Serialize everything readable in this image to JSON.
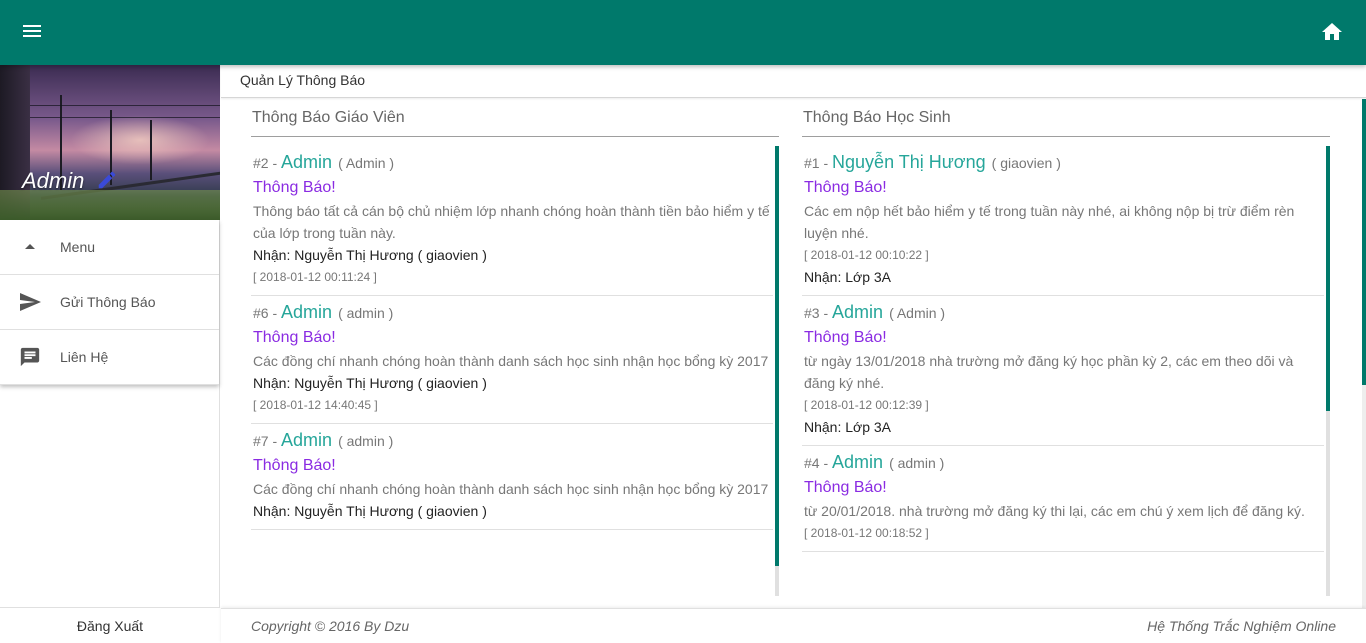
{
  "header": {
    "menu_icon": "hamburger-icon",
    "home_icon": "home-icon",
    "bar_color": "#00796b"
  },
  "sidebar": {
    "user_name": "Admin",
    "items": [
      {
        "label": "Menu",
        "icon": "arrow-up-icon"
      },
      {
        "label": "Gửi Thông Báo",
        "icon": "send-icon"
      },
      {
        "label": "Liên Hệ",
        "icon": "message-icon"
      }
    ],
    "logout_label": "Đăng Xuất"
  },
  "main": {
    "title": "Quản Lý Thông Báo",
    "teacher": {
      "heading": "Thông Báo Giáo Viên",
      "items": [
        {
          "id": "#2",
          "sender": "Admin",
          "role": "( Admin )",
          "subject": "Thông Báo!",
          "content": "Thông báo tất cả cán bộ chủ nhiệm lớp nhanh chóng hoàn thành tiền bảo hiểm y tế của lớp trong tuần này.",
          "recipient": "Nhận: Nguyễn Thị Hương ( giaovien )",
          "time": "[ 2018-01-12 00:11:24 ]"
        },
        {
          "id": "#6",
          "sender": "Admin",
          "role": "( admin )",
          "subject": "Thông Báo!",
          "content": "Các đồng chí nhanh chóng hoàn thành danh sách học sinh nhận học bổng kỳ 2017",
          "recipient": "Nhận: Nguyễn Thị Hương ( giaovien )",
          "time": "[ 2018-01-12 14:40:45 ]"
        },
        {
          "id": "#7",
          "sender": "Admin",
          "role": "( admin )",
          "subject": "Thông Báo!",
          "content": "Các đồng chí nhanh chóng hoàn thành danh sách học sinh nhận học bổng kỳ 2017",
          "recipient": "Nhận: Nguyễn Thị Hương ( giaovien )",
          "time": ""
        }
      ]
    },
    "student": {
      "heading": "Thông Báo Học Sinh",
      "items": [
        {
          "id": "#1",
          "sender": "Nguyễn Thị Hương",
          "role": "( giaovien )",
          "subject": "Thông Báo!",
          "content": "Các em nộp hết bảo hiểm y tế trong tuần này nhé, ai không nộp bị trừ điểm rèn luyện nhé.",
          "time": "[ 2018-01-12 00:10:22 ]",
          "recipient": "Nhận: Lớp 3A"
        },
        {
          "id": "#3",
          "sender": "Admin",
          "role": "( Admin )",
          "subject": "Thông Báo!",
          "content": "từ ngày 13/01/2018 nhà trường mở đăng ký học phần kỳ 2, các em theo dõi và đăng ký nhé.",
          "time": "[ 2018-01-12 00:12:39 ]",
          "recipient": "Nhận: Lớp 3A"
        },
        {
          "id": "#4",
          "sender": "Admin",
          "role": "( admin )",
          "subject": "Thông Báo!",
          "content": "từ 20/01/2018. nhà trường mở đăng ký thi lại, các em chú ý xem lịch để đăng ký.",
          "time": "[ 2018-01-12 00:18:52 ]",
          "recipient": ""
        }
      ]
    }
  },
  "footer": {
    "copyright": "Copyright © 2016 By Dzu",
    "system_name": "Hệ Thống Trắc Nghiệm Online"
  }
}
